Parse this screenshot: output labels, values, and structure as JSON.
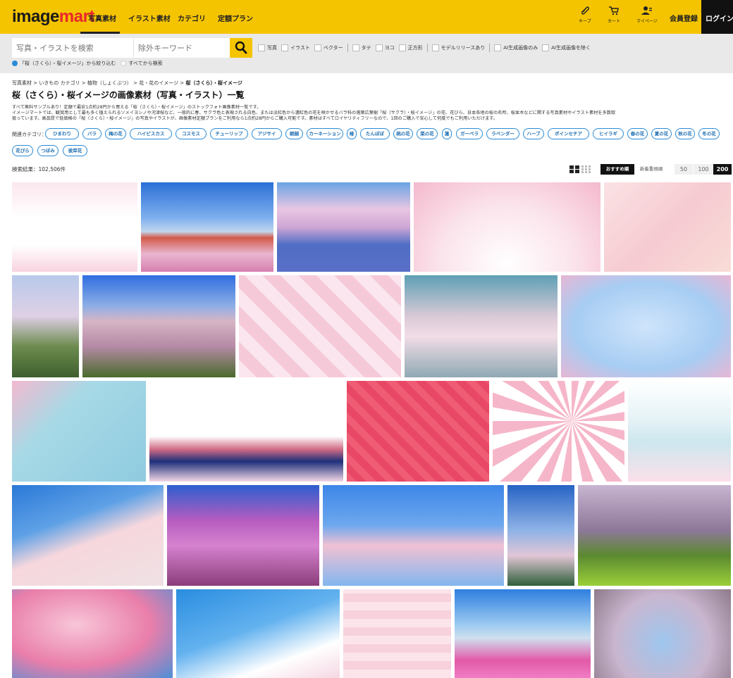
{
  "header": {
    "logo_main": "image",
    "logo_accent": "mart",
    "nav": [
      "写真素材",
      "イラスト素材",
      "カテゴリ",
      "定額プラン"
    ],
    "icons": [
      {
        "name": "keep-icon",
        "label": "キープ"
      },
      {
        "name": "cart-icon",
        "label": "カート"
      },
      {
        "name": "mypage-icon",
        "label": "マイページ"
      }
    ],
    "register": "会員登録",
    "login": "ログイン"
  },
  "search": {
    "placeholder": "写真・イラストを検索",
    "exclude_placeholder": "除外キーワード",
    "filters": [
      "写真",
      "イラスト",
      "ベクター",
      "タテ",
      "ヨコ",
      "正方形",
      "モデルリリースあり",
      "AI生成画像のみ",
      "AI生成画像を除く"
    ],
    "radio_on": "「桜（さくら）・桜イメージ」から絞り込む",
    "radio_off": "すべてから検索"
  },
  "breadcrumb": {
    "items": [
      "写真素材",
      "いきもの カテゴリ",
      "植物（しょくぶつ）",
      "花・花のイメージ"
    ],
    "separator": ">",
    "current": "桜（さくら）・桜イメージ"
  },
  "page_title": "桜（さくら）・桜イメージの画像素材（写真・イラスト）一覧",
  "description": [
    "すべて無料サンプルあり！定額で最安1点約28円から買える「桜（さくら）・桜イメージ」のストックフォト画像素材一覧です。",
    "イメージマートでは、観賞用として最も多く植えられるソメイヨシノや河津桜など、一般的に春、サクラ色と表現される白色、または淡紅色から濃紅色の花を咲かせるバラ科の落葉広葉樹「桜（サクラ）・桜イメージ」の花、花びら、日本各地の桜の名所、桜並木などに関する写真素材やイラスト素材を多数取",
    "扱っています。高品質で低価格の「桜（さくら）・桜イメージ」の写真やイラストが、画像素材定額プランをご利用なら1点約28円からご購入可能です。素材はすべてロイヤリティフリーなので、1回のご購入で安心して何度でもご利用いただけます。"
  ],
  "related_label": "関連カテゴリ：",
  "related": [
    "ひまわり",
    "バラ",
    "梅の花",
    "ハイビスカス",
    "コスモス",
    "チューリップ",
    "アジサイ",
    "朝顔",
    "カーネーション",
    "椿",
    "たんぽぽ",
    "桃の花",
    "菜の花",
    "蓮",
    "ガーベラ",
    "ラベンダー",
    "ハーブ",
    "ポインセチア",
    "ヒイラギ",
    "春の花",
    "夏の花",
    "秋の花",
    "冬の花",
    "花びら",
    "つぼみ",
    "彼岸花"
  ],
  "results": {
    "count": "検索結果：102,506件",
    "sort_active": "おすすめ順",
    "sort_other": "新着重視順",
    "per_page": [
      "50",
      "100",
      "200"
    ],
    "per_page_active": "200"
  }
}
